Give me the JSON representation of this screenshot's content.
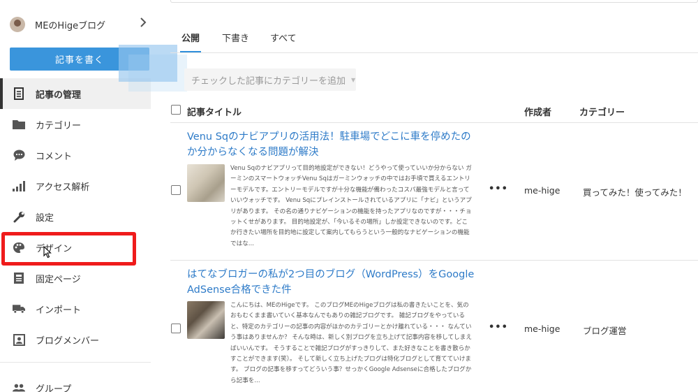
{
  "sidebar": {
    "blog_name": "MEのHigeブログ",
    "write_button": "記事を書く",
    "items": [
      {
        "label": "記事の管理",
        "icon": "document-icon"
      },
      {
        "label": "カテゴリー",
        "icon": "folder-icon"
      },
      {
        "label": "コメント",
        "icon": "comment-icon"
      },
      {
        "label": "アクセス解析",
        "icon": "bar-chart-icon"
      },
      {
        "label": "設定",
        "icon": "wrench-icon"
      },
      {
        "label": "デザイン",
        "icon": "palette-icon"
      },
      {
        "label": "固定ページ",
        "icon": "page-icon"
      },
      {
        "label": "インポート",
        "icon": "truck-icon"
      },
      {
        "label": "ブログメンバー",
        "icon": "member-icon"
      },
      {
        "label": "グループ",
        "icon": "group-icon"
      }
    ]
  },
  "main": {
    "tabs": [
      "公開",
      "下書き",
      "すべて"
    ],
    "category_button": "チェックした記事にカテゴリーを追加",
    "columns": {
      "title": "記事タイトル",
      "author": "作成者",
      "category": "カテゴリー"
    },
    "posts": [
      {
        "title": "Venu Sqのナビアプリの活用法！駐車場でどこに車を停めたのか分からなくなる問題が解決",
        "excerpt": "Venu Sqのナビアプリって目的地設定ができない！どうやって使っていいか分からない ガーミンのスマートウォッチVenu Sqはガーミンウォッチの中ではお手頃で買えるエントリーモデルです。エントリーモデルですが十分な機能が備わったコスパ最強モデルと言っていいウォッチです。 Venu Sqにプレインストールされているアプリに「ナビ」というアプリがあります。 その名の通りナビゲーションの機能を持ったアプリなのですが・・・チョットくせがあります。 目的地設定が、「今いるその場所」しか設定できないのです。どこか行きたい場所を目的地に設定して案内してもらうという一般的なナビゲーションの機能ではな...",
        "actions": "•••",
        "author": "me-hige",
        "category": "買ってみた！使ってみた！"
      },
      {
        "title": "はてなブロガーの私が2つ目のブログ（WordPress）をGoogle AdSense合格できた件",
        "excerpt": "こんにちは、MEのHigeです。 このブログMEのHigeブログは私の書きたいことを、気のおもむくまま書いていく基本なんでもありの雑記ブログです。 雑記ブログをやっていると、特定のカテゴリーの記事の内容がほかのカテゴリーとかけ離れている・・・ なんていう事はありませんか？ そんな時は、新しく別ブログを立ち上げて記事内容を移してしまえばいいんです。 そうすることで雑記ブログがすっきりして、また好きなことを書き散らかすことができます(笑）。 そして新しく立ち上げたブログは特化ブログとして育てていけます。 ブログの記事を移すってどういう事？せっかくGoogle Adsenseに合格したブログから記事を...",
        "actions": "•••",
        "author": "me-hige",
        "category": "ブログ運営"
      }
    ]
  },
  "colors": {
    "accent": "#3a95dc",
    "link": "#2e7bc8",
    "highlight": "#ef1b1b"
  }
}
